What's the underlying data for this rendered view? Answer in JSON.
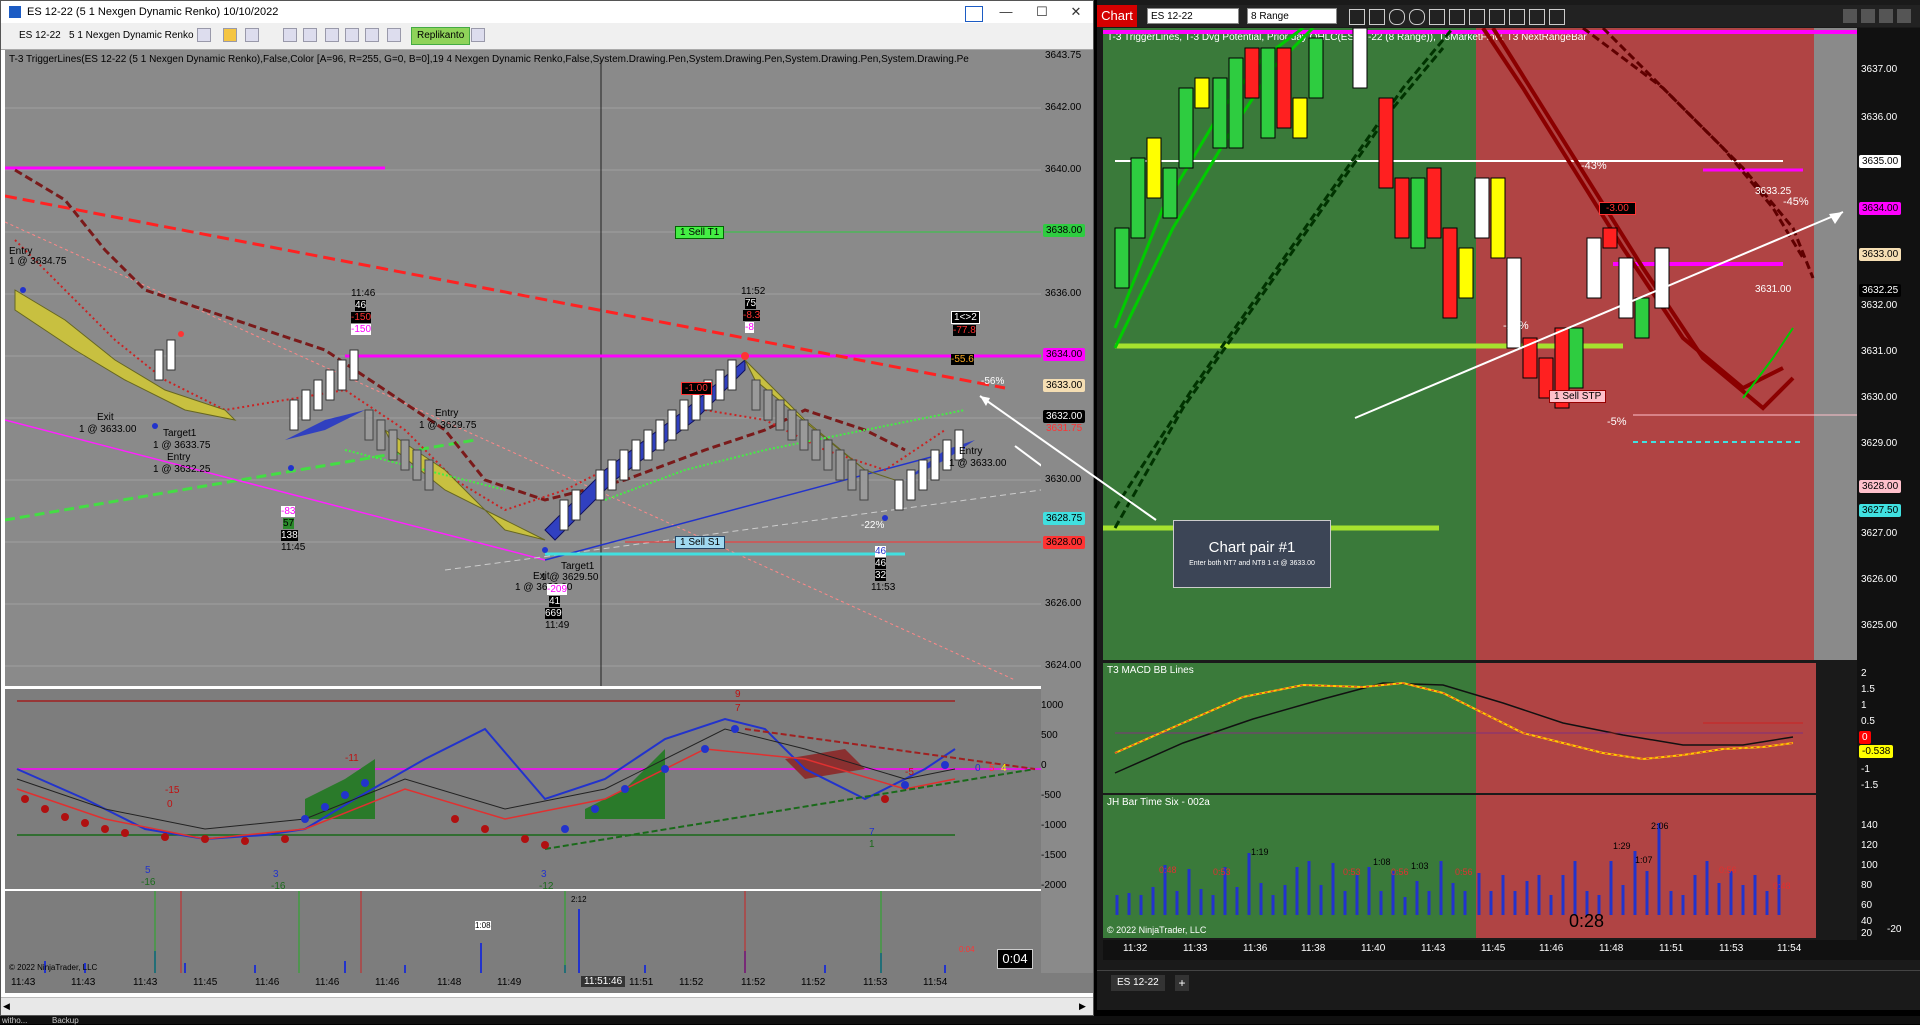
{
  "left_window": {
    "title": "ES 12-22 (5 1 Nexgen Dynamic Renko)  10/10/2022",
    "controls": {
      "minimize": "—",
      "maximize": "☐",
      "close": "✕"
    },
    "toolbar": {
      "instrument": "ES 12-22",
      "bar_type": "5 1 Nexgen Dynamic Renko",
      "replikanto": "Replikanto"
    },
    "indicator_header": "T-3 TriggerLines(ES 12-22 (5 1 Nexgen Dynamic Renko),False,Color [A=96, R=255, G=0, B=0],19 4 Nexgen Dynamic Renko,False,System.Drawing.Pen,System.Drawing.Pen,System.Drawing.Pen,System.Drawing.Pe",
    "y_ticks": [
      "3643.75",
      "3642.00",
      "3640.00",
      "3638.00",
      "3636.00",
      "3634.00",
      "3632.00",
      "3630.00",
      "3628.00",
      "3626.00",
      "3624.00"
    ],
    "price_labels": [
      {
        "text": "3638.00",
        "color": "#2ecc40"
      },
      {
        "text": "3634.00",
        "color": "#ff00ff"
      },
      {
        "text": "3633.00",
        "color": "#f5deb3"
      },
      {
        "text": "3632.00",
        "color": "#000000"
      },
      {
        "text": "3631.75",
        "color": "#ff3333"
      },
      {
        "text": "3628.75",
        "color": "#40e0e0"
      },
      {
        "text": "3628.00",
        "color": "#ff3333"
      }
    ],
    "annotations": [
      "Entry",
      "1 @ 3634.75",
      "Exit",
      "1 @ 3633.00",
      "Target1",
      "1 @ 3633.75",
      "Entry",
      "1 @ 3632.25",
      "Entry",
      "1 @ 3629.75",
      "11:46",
      "46",
      "-150",
      "-150",
      "-83",
      "57",
      "138",
      "11:45",
      "11:52",
      "75",
      "-8.3",
      "-8",
      "1 Sell T1",
      "1 Sell S1",
      "Target1",
      "1 @ 3629.50",
      "Exit",
      "1 @ 3626.00",
      "-209",
      "41",
      "669",
      "11:49",
      "46",
      "46",
      "32",
      "11:53",
      "-1.00",
      "-22%",
      "-56%",
      "Entry",
      "1 @ 3633.00",
      "1<>2",
      "-77.8",
      "-55.6"
    ],
    "osc_ticks": [
      "1000",
      "500",
      "0",
      "-500",
      "-1000",
      "-1500",
      "-2000"
    ],
    "osc_labels": [
      "9",
      "7",
      "-11",
      "-15",
      "0",
      "-5",
      "5",
      "-16",
      "3",
      "-16",
      "3",
      "-12",
      "7",
      "1",
      "0",
      "5",
      "4"
    ],
    "bar_labels": [
      "1:08",
      "2:12",
      "0:04"
    ],
    "x_ticks": [
      "11:43",
      "11:43",
      "11:43",
      "11:45",
      "11:46",
      "11:46",
      "11:46",
      "11:48",
      "11:49",
      "11:51:46",
      "11:51",
      "11:52",
      "11:52",
      "11:52",
      "11:53",
      "11:54"
    ],
    "copyright": "© 2022 NinjaTrader, LLC",
    "timer": "0:04"
  },
  "right_window": {
    "tab": "Chart",
    "instrument": "ES 12-22",
    "bar_type": "8 Range",
    "indicator_header": "T-3 TriggerLines,  T-3 Dvg Potential, Prior day OHLC(ES 12-22 (8 Range)),  T3MarketFlow,  T3 NextRangeBar",
    "y_ticks": [
      "3637.00",
      "3636.00",
      "3635.00",
      "3634.00",
      "3633.00",
      "3632.00",
      "3631.00",
      "3630.00",
      "3629.00",
      "3628.00",
      "3627.00",
      "3626.00",
      "3625.00"
    ],
    "price_labels": [
      {
        "text": "3635.00",
        "color": "#ffffff"
      },
      {
        "text": "3634.00",
        "color": "#ff00ff"
      },
      {
        "text": "3633.00",
        "color": "#f5deb3"
      },
      {
        "text": "3632.25",
        "color": "#000000"
      },
      {
        "text": "3628.00",
        "color": "#ffc0cb"
      },
      {
        "text": "3627.50",
        "color": "#40e0e0"
      }
    ],
    "annotations": [
      "-43%",
      "-45%",
      "3633.25",
      "3631.00",
      "-15%",
      "-5%",
      "1 Sell STP",
      "-3.00"
    ],
    "macd_title": "T3 MACD BB Lines",
    "macd_ticks": [
      "2",
      "1.5",
      "1",
      "0.5",
      "0",
      "-0.5",
      "-1",
      "-1.5"
    ],
    "macd_labels": [
      {
        "text": "0",
        "color": "#ff0000"
      },
      {
        "text": "-0.538",
        "color": "#ffff00"
      }
    ],
    "time_title": "JH Bar Time Six - 002a",
    "time_ticks": [
      "140",
      "120",
      "100",
      "80",
      "60",
      "40",
      "20",
      "-20"
    ],
    "time_labels": [
      "1:19",
      "1:08",
      "1:03",
      "0:48",
      "0:53",
      "0:53",
      "0:56",
      "0:56",
      "2:06",
      "1:29",
      "1:07",
      "0:56",
      "0:48"
    ],
    "time_countdown": "0:28",
    "copyright": "© 2022 NinjaTrader, LLC",
    "x_ticks": [
      "11:32",
      "11:33",
      "11:36",
      "11:38",
      "11:40",
      "11:43",
      "11:45",
      "11:46",
      "11:48",
      "11:51",
      "11:53",
      "11:54"
    ],
    "bottom_tab": "ES 12-22",
    "add_tab": "+"
  },
  "chart_pair": {
    "heading": "Chart pair #1",
    "subtext": "Enter both NT7 and NT8 1 ct @ 3633.00"
  },
  "taskbar": {
    "item1": "witho...",
    "item2": "Backup"
  }
}
